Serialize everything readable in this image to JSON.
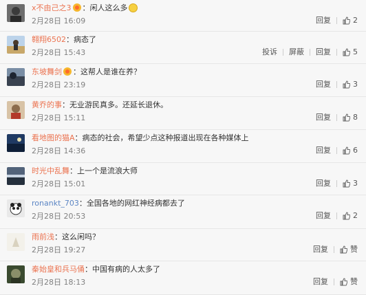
{
  "comments": [
    {
      "user": "x不由己之3",
      "vip": true,
      "text": "闲人这么多",
      "emoji": true,
      "date": "2月28日 16:09",
      "reply": "回复",
      "likes": "2",
      "extra": []
    },
    {
      "user": "翱翔6502",
      "vip": false,
      "text": "病态了",
      "emoji": false,
      "date": "2月28日 15:43",
      "reply": "回复",
      "likes": "5",
      "extra": [
        "投诉",
        "屏蔽"
      ]
    },
    {
      "user": "东坡舞剑",
      "vip": true,
      "text": "这帮人是谁在养？",
      "emoji": false,
      "date": "2月28日 23:19",
      "reply": "回复",
      "likes": "3",
      "extra": []
    },
    {
      "user": "黄乔的事",
      "vip": false,
      "text": "无业游民真多。还延长退休。",
      "emoji": false,
      "date": "2月28日 15:11",
      "reply": "回复",
      "likes": "8",
      "extra": []
    },
    {
      "user": "看地图的猫A",
      "vip": false,
      "text": "病态的社会，希望少点这种报道出现在各种媒体上",
      "emoji": false,
      "date": "2月28日 14:36",
      "reply": "回复",
      "likes": "6",
      "extra": []
    },
    {
      "user": "时光中乱舞",
      "vip": false,
      "text": "上一个是流浪大师",
      "emoji": false,
      "date": "2月28日 15:01",
      "reply": "回复",
      "likes": "3",
      "extra": []
    },
    {
      "user": "ronankt_703",
      "vip": false,
      "text": "全国各地的网红神经病都去了",
      "emoji": false,
      "date": "2月28日 20:53",
      "reply": "回复",
      "likes": "2",
      "extra": []
    },
    {
      "user": "雨前浅",
      "vip": false,
      "text": "这么闲吗？",
      "emoji": false,
      "date": "2月28日 19:27",
      "reply": "回复",
      "likes": "赞",
      "extra": []
    },
    {
      "user": "秦始皇和兵马俑",
      "vip": false,
      "text": "中国有病的人太多了",
      "emoji": false,
      "date": "2月28日 18:13",
      "reply": "回复",
      "likes": "赞",
      "extra": []
    }
  ],
  "colon": "：",
  "colors": {
    "username": "#eb7350",
    "text": "#333333",
    "meta": "#808080",
    "background": "#f7f7f7"
  },
  "icons": {
    "like": "thumbs-up-icon",
    "vip": "vip-badge-icon",
    "emoji": "emoji-icon"
  }
}
